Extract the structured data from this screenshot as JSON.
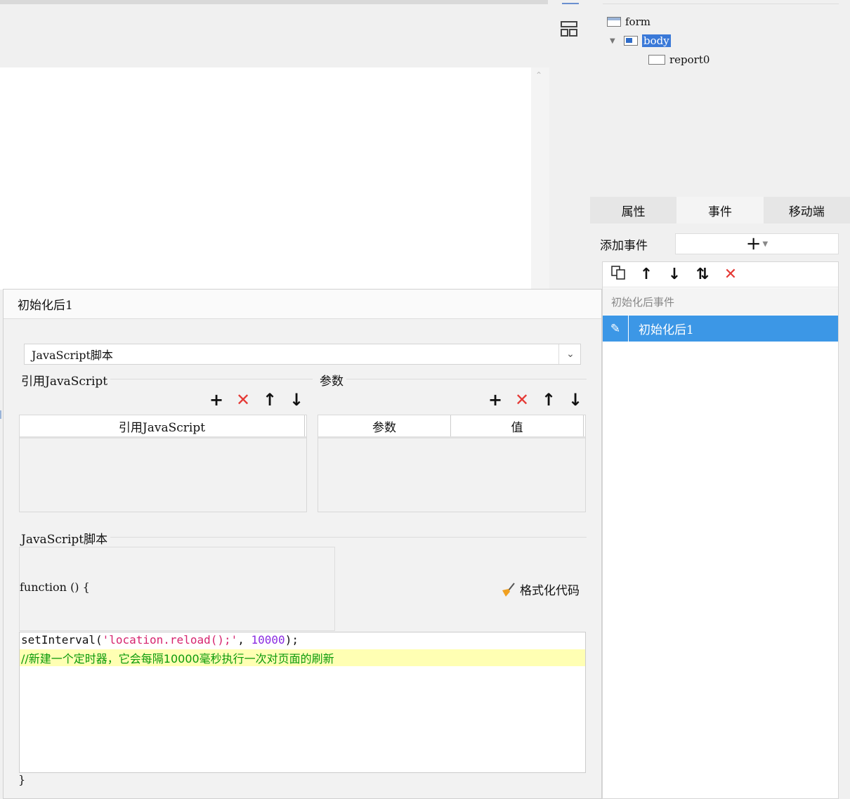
{
  "structure_tree": {
    "items": [
      {
        "label": "form"
      },
      {
        "label": "body"
      },
      {
        "label": "report0"
      }
    ]
  },
  "tabs": [
    {
      "label": "属性"
    },
    {
      "label": "事件"
    },
    {
      "label": "移动端"
    }
  ],
  "add_event": {
    "label": "添加事件",
    "button": "+"
  },
  "event_list": {
    "group_label": "初始化后事件",
    "selected_item": "初始化后1"
  },
  "dialog": {
    "title": "初始化后1",
    "script_type": "JavaScript脚本",
    "ref_js": {
      "title": "引用JavaScript",
      "column": "引用JavaScript"
    },
    "params": {
      "title": "参数",
      "columns": [
        "参数",
        "值"
      ]
    },
    "script": {
      "title": "JavaScript脚本",
      "signature": "function () {",
      "format_label": "格式化代码",
      "line1_fn": "setInterval(",
      "line1_str": "'location.reload();'",
      "line1_sep": ", ",
      "line1_num": "10000",
      "line1_end": ");",
      "line2_comment": "//新建一个定时器，它会每隔10000毫秒执行一次对页面的刷新",
      "closing": "}"
    }
  },
  "colors": {
    "selection_blue": "#3c97e6",
    "delete_red": "#e53935",
    "comment_green": "#0a9a0a",
    "highlight_yellow": "#ffffb3"
  }
}
